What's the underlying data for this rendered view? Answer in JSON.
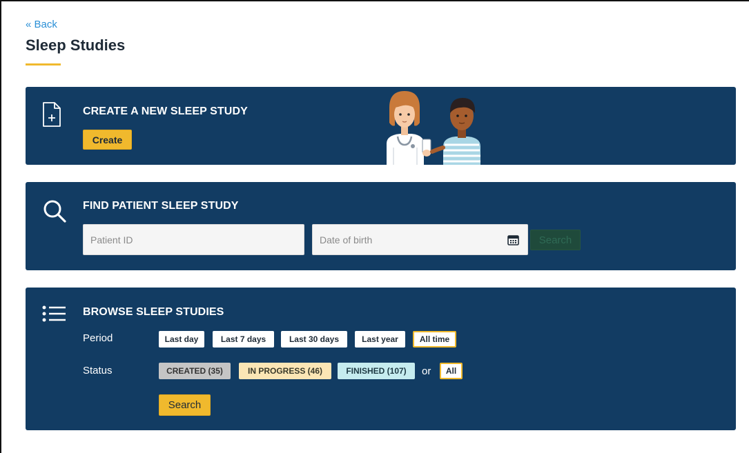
{
  "nav": {
    "back_label": "« Back"
  },
  "page": {
    "title": "Sleep Studies"
  },
  "create_card": {
    "heading": "CREATE A NEW SLEEP STUDY",
    "create_label": "Create"
  },
  "find_card": {
    "heading": "FIND PATIENT SLEEP STUDY",
    "patient_id_placeholder": "Patient ID",
    "dob_placeholder": "Date of birth",
    "search_label": "Search"
  },
  "browse_card": {
    "heading": "BROWSE SLEEP STUDIES",
    "period_label": "Period",
    "periods": [
      "Last day",
      "Last 7 days",
      "Last 30 days",
      "Last year",
      "All time"
    ],
    "selected_period": "All time",
    "status_label": "Status",
    "statuses": [
      "CREATED (35)",
      "IN PROGRESS (46)",
      "FINISHED (107)"
    ],
    "or_label": "or",
    "all_label": "All",
    "search_label": "Search"
  },
  "colors": {
    "card_bg": "#123c63",
    "accent": "#f0b92d",
    "link": "#2a8fd6"
  },
  "icons": [
    "new-document-icon",
    "search-icon",
    "list-icon",
    "calendar-icon"
  ]
}
